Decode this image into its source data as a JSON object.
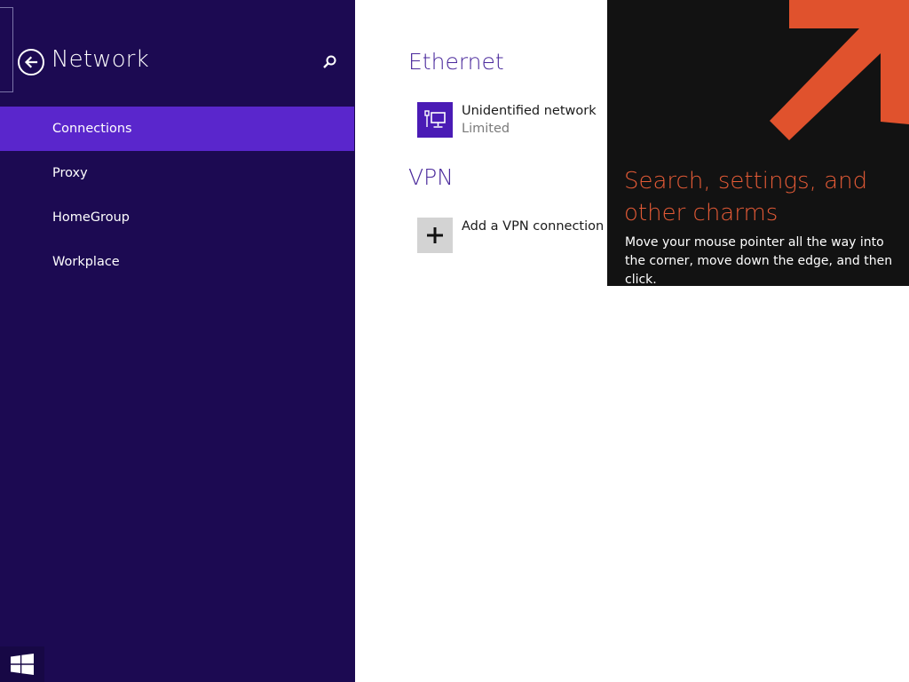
{
  "nav": {
    "title": "Network",
    "back_icon": "back-arrow-icon",
    "search_icon": "search-icon",
    "items": [
      {
        "label": "Connections",
        "selected": true
      },
      {
        "label": "Proxy",
        "selected": false
      },
      {
        "label": "HomeGroup",
        "selected": false
      },
      {
        "label": "Workplace",
        "selected": false
      }
    ],
    "start_icon": "windows-logo-icon"
  },
  "main": {
    "ethernet": {
      "heading": "Ethernet",
      "connection": {
        "name": "Unidentified network",
        "status": "Limited",
        "icon": "wired-network-icon"
      }
    },
    "vpn": {
      "heading": "VPN",
      "add_label": "Add a VPN connection",
      "add_icon": "plus-icon"
    }
  },
  "charms_tip": {
    "title": "Search, settings, and other charms",
    "body": "Move your mouse pointer all the way into the corner, move down the edge, and then click.",
    "arrow_icon": "corner-arrow-icon"
  },
  "colors": {
    "nav_bg": "#1c0a52",
    "nav_selected": "#5a26cc",
    "heading": "#4b2a9c",
    "tip_bg": "#121212",
    "tip_accent": "#e35a36"
  }
}
